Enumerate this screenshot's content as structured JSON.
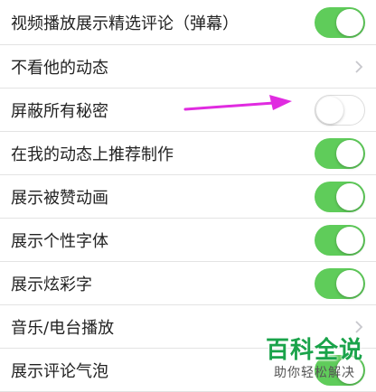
{
  "settings": {
    "items": [
      {
        "label": "视频播放展示精选评论（弹幕）",
        "control": "toggle",
        "on": true
      },
      {
        "label": "不看他的动态",
        "control": "chevron"
      },
      {
        "label": "屏蔽所有秘密",
        "control": "toggle",
        "on": false
      },
      {
        "label": "在我的动态上推荐制作",
        "control": "toggle",
        "on": true
      },
      {
        "label": "展示被赞动画",
        "control": "toggle",
        "on": true
      },
      {
        "label": "展示个性字体",
        "control": "toggle",
        "on": true
      },
      {
        "label": "展示炫彩字",
        "control": "toggle",
        "on": true
      },
      {
        "label": "音乐/电台播放",
        "control": "chevron"
      },
      {
        "label": "展示评论气泡",
        "control": "toggle",
        "on": true
      }
    ]
  },
  "colors": {
    "toggle_on": "#5fcc5a",
    "annotation_arrow": "#e02be0",
    "watermark_green": "#1aa34a"
  },
  "icons": {
    "chevron": "chevron-right-icon",
    "annotation": "arrow-left-icon"
  },
  "watermark": {
    "title": "百科全说",
    "subtitle": "助你轻松解决"
  }
}
